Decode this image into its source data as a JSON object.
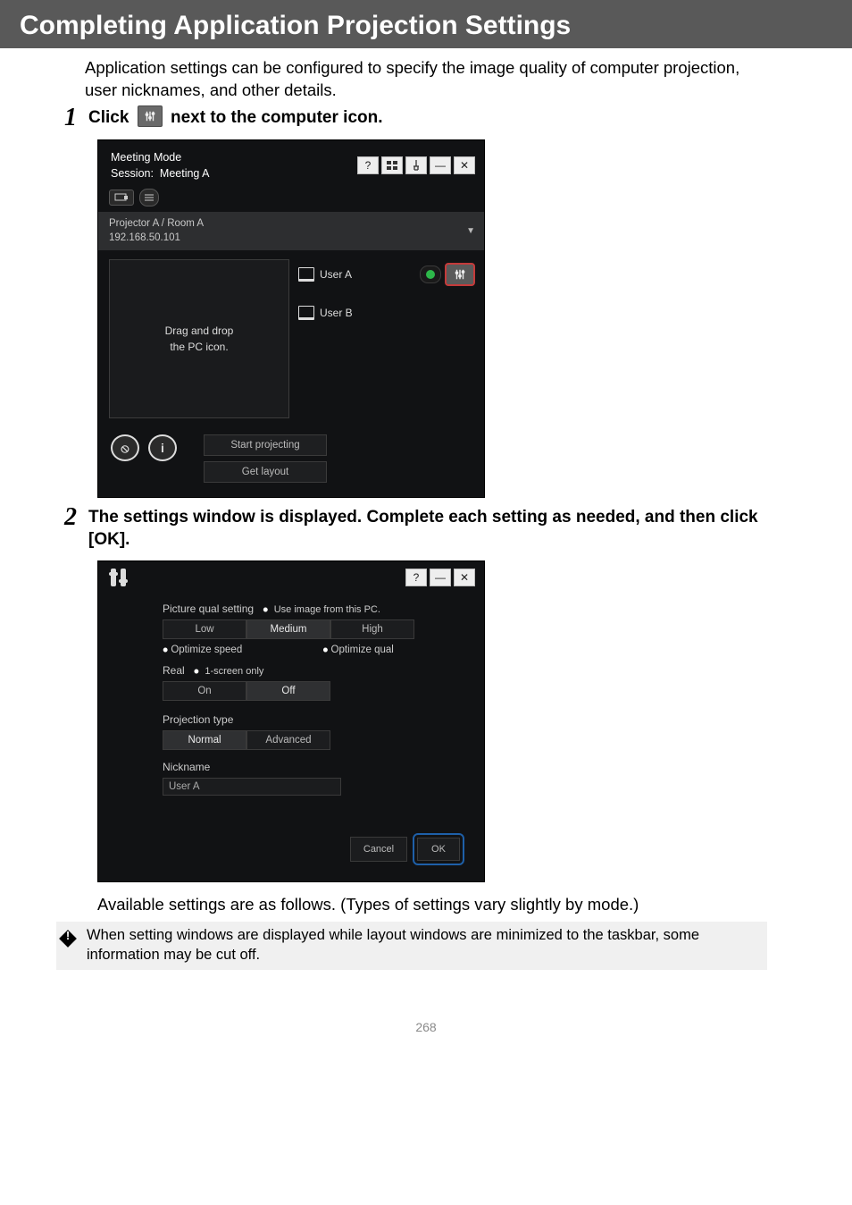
{
  "header": {
    "title": "Completing Application Projection Settings"
  },
  "intro": "Application settings can be configured to specify the image quality of computer projection, user nicknames, and other details.",
  "step1": {
    "num": "1",
    "pre": "Click ",
    "post": " next to the computer icon."
  },
  "step2": {
    "num": "2",
    "text": "The settings window is displayed. Complete each setting as needed, and then click [OK]."
  },
  "shot1": {
    "title_line1": "Meeting Mode",
    "session_label": "Session:",
    "session_name": "Meeting A",
    "projector_name": "Projector A / Room A",
    "projector_ip": "192.168.50.101",
    "drag_text_l1": "Drag and drop",
    "drag_text_l2": "the PC icon.",
    "userA": "User A",
    "userB": "User B",
    "start_btn": "Start projecting",
    "getlayout_btn": "Get layout"
  },
  "shot2": {
    "row1_label": "Picture qual setting",
    "row1_hint": "Use image from this PC.",
    "low": "Low",
    "med": "Medium",
    "high": "High",
    "opt_speed": "Optimize speed",
    "opt_qual": "Optimize qual",
    "real_label": "Real",
    "real_hint": "1-screen only",
    "on": "On",
    "off": "Off",
    "proj_type": "Projection type",
    "normal": "Normal",
    "advanced": "Advanced",
    "nickname": "Nickname",
    "nick_val": "User A",
    "cancel": "Cancel",
    "ok": "OK"
  },
  "avail": "Available settings are as follows. (Types of settings vary slightly by mode.)",
  "note": "When setting windows are displayed while layout windows are minimized to the taskbar, some information may be cut off.",
  "page_number": "268"
}
